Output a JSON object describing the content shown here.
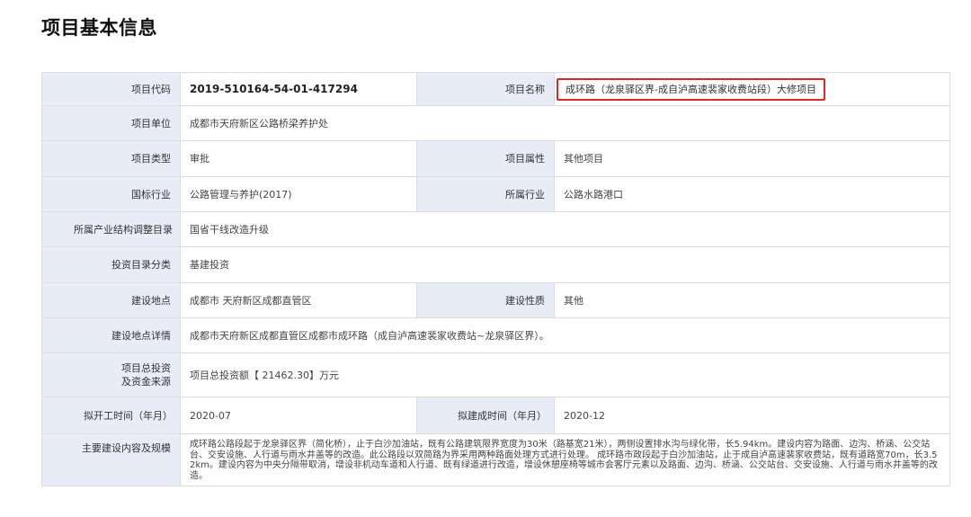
{
  "page": {
    "title": "项目基本信息"
  },
  "rows": {
    "project_code": {
      "label": "项目代码",
      "value": "2019-510164-54-01-417294"
    },
    "project_name": {
      "label": "项目名称",
      "value": "成环路（龙泉驿区界-成自泸高速裴家收费站段）大修项目"
    },
    "project_unit": {
      "label": "项目单位",
      "value": "成都市天府新区公路桥梁养护处"
    },
    "project_type": {
      "label": "项目类型",
      "value": "审批"
    },
    "project_attr": {
      "label": "项目属性",
      "value": "其他项目"
    },
    "national_industry": {
      "label": "国标行业",
      "value": "公路管理与养护(2017)"
    },
    "industry": {
      "label": "所属行业",
      "value": "公路水路港口"
    },
    "industry_catalog": {
      "label": "所属产业结构调整目录",
      "value": "国省干线改造升级"
    },
    "investment_catalog": {
      "label": "投资目录分类",
      "value": "基建投资"
    },
    "location": {
      "label": "建设地点",
      "value": "成都市 天府新区成都直管区"
    },
    "nature": {
      "label": "建设性质",
      "value": "其他"
    },
    "location_detail": {
      "label": "建设地点详情",
      "value": "成都市天府新区成都直管区成都市成环路（成自泸高速裴家收费站~龙泉驿区界）。"
    },
    "investment": {
      "label_line1": "项目总投资",
      "label_line2": "及资金来源",
      "value": "项目总投资额【 21462.30】万元"
    },
    "start_time": {
      "label": "拟开工时间（年月）",
      "value": "2020-07"
    },
    "end_time": {
      "label": "拟建成时间（年月）",
      "value": "2020-12"
    },
    "content": {
      "label": "主要建设内容及规模",
      "value": "成环路公路段起于龙泉驿区界（简化桥），止于白沙加油站，既有公路建筑限界宽度为30米（路基宽21米），两侧设置排水沟与绿化带，长5.94km。建设内容为路面、边沟、桥涵、公交站台、交安设施、人行道与雨水井盖等的改造。此公路段以双简路为界采用两种路面处理方式进行处理。 成环路市政段起于白沙加油站，止于成自泸高速裴家收费站，既有道路宽70m，长3.52km。建设内容为中央分隔带取消，增设非机动车道和人行道、既有绿道进行改造，增设休憩座椅等城市会客厅元素以及路面、边沟、桥涵、公交站台、交安设施、人行道与雨水井盖等的改造。"
    }
  }
}
